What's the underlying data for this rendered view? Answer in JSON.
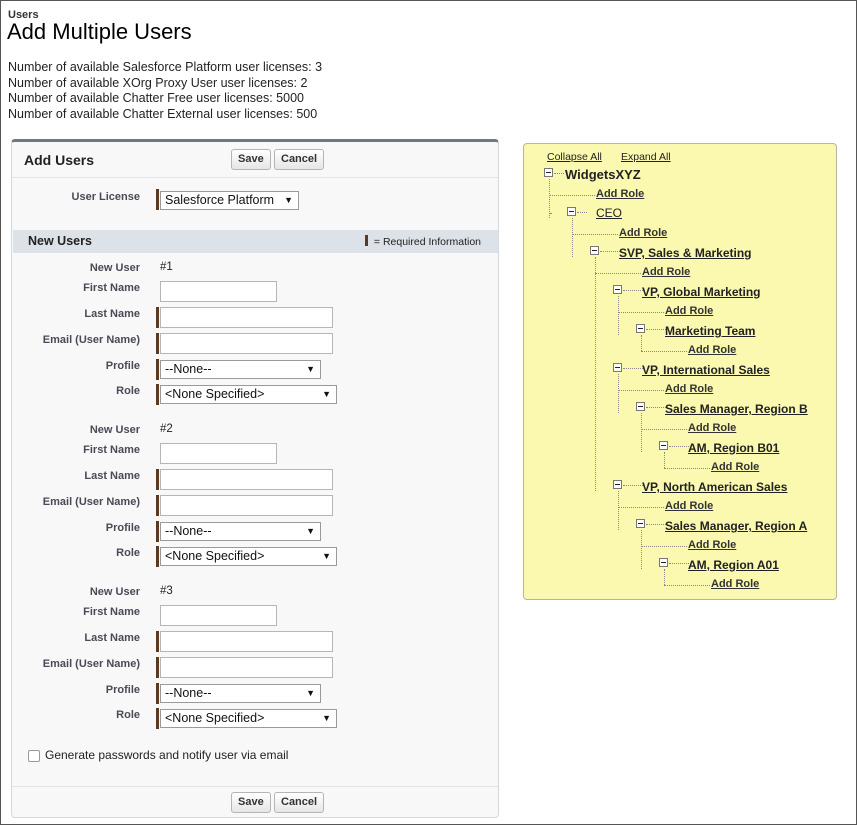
{
  "breadcrumb": "Users",
  "title": "Add Multiple Users",
  "licenses": [
    "Number of available Salesforce Platform user licenses: 3",
    "Number of available XOrg Proxy User user licenses: 2",
    "Number of available Chatter Free user licenses: 5000",
    "Number of available Chatter External user licenses: 500"
  ],
  "form": {
    "title": "Add Users",
    "save_label": "Save",
    "cancel_label": "Cancel",
    "user_license_label": "User License",
    "user_license_value": "Salesforce Platform",
    "section_title": "New Users",
    "required_legend": "= Required Information",
    "labels": {
      "new_user": "New User",
      "first_name": "First Name",
      "last_name": "Last Name",
      "email": "Email (User Name)",
      "profile": "Profile",
      "role": "Role"
    },
    "users": [
      {
        "number": "#1",
        "profile": "--None--",
        "role": "<None Specified>"
      },
      {
        "number": "#2",
        "profile": "--None--",
        "role": "<None Specified>"
      },
      {
        "number": "#3",
        "profile": "--None--",
        "role": "<None Specified>"
      }
    ],
    "notify_label": "Generate passwords and notify user via email"
  },
  "tree": {
    "collapse_all": "Collapse All",
    "expand_all": "Expand All",
    "root": "WidgetsXYZ",
    "add_role": "Add Role",
    "nodes": {
      "ceo": "CEO",
      "svp": "SVP, Sales & Marketing",
      "vp_global": "VP, Global Marketing",
      "marketing_team": "Marketing Team",
      "vp_intl": "VP, International Sales",
      "sm_b": "Sales Manager, Region B",
      "am_b01": "AM, Region B01",
      "vp_na": "VP, North American Sales",
      "sm_a": "Sales Manager, Region A",
      "am_a01": "AM, Region A01"
    }
  }
}
